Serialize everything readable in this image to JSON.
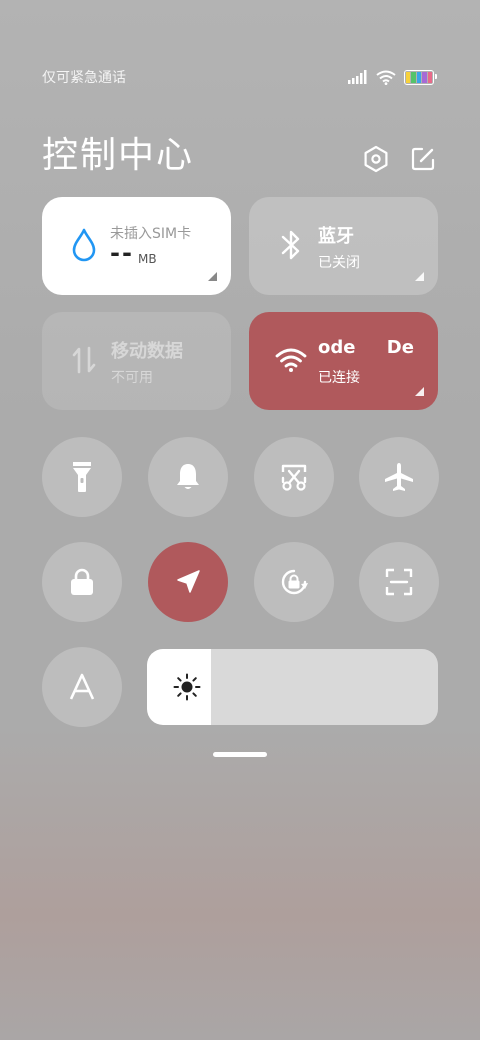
{
  "status": {
    "carrier": "仅可紧急通话"
  },
  "header": {
    "title": "控制中心"
  },
  "tiles": {
    "data": {
      "title": "未插入SIM卡",
      "value": "--",
      "unit": "MB"
    },
    "bluetooth": {
      "title": "蓝牙",
      "status": "已关闭"
    },
    "mobile": {
      "title": "移动数据",
      "status": "不可用"
    },
    "wifi": {
      "title": "ode     De",
      "status": "已连接"
    }
  },
  "brightness": {
    "level_percent": 22
  },
  "colors": {
    "accent": "#b0595c",
    "tile_light": "#ffffff",
    "tile_translucent": "rgba(255,255,255,0.22)",
    "data_icon": "#2196f3"
  },
  "icons": {
    "header": [
      "settings-icon",
      "edit-icon"
    ],
    "round_row1": [
      "flashlight-icon",
      "bell-icon",
      "screenshot-icon",
      "airplane-icon"
    ],
    "round_row2": [
      "lock-icon",
      "location-icon",
      "rotation-lock-icon",
      "scan-icon"
    ],
    "round_row3": [
      "auto-brightness-icon"
    ]
  }
}
